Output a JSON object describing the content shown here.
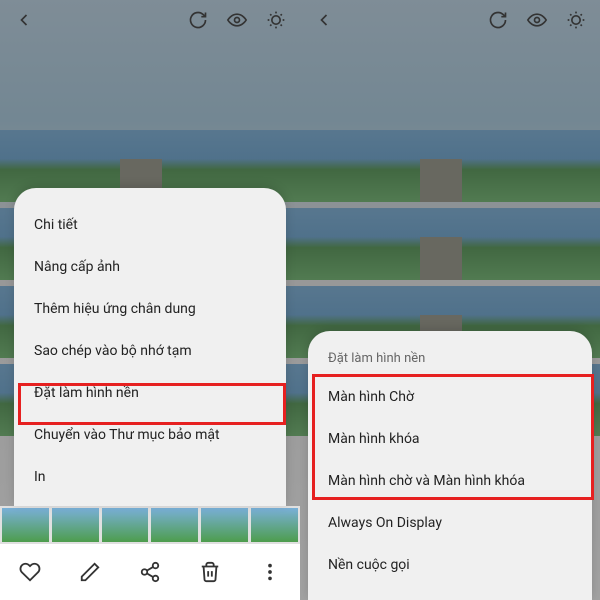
{
  "left": {
    "menu": {
      "items": [
        "Chi tiết",
        "Nâng cấp ảnh",
        "Thêm hiệu ứng chân dung",
        "Sao chép vào bộ nhớ tạm",
        "Đặt làm hình nền",
        "Chuyển vào Thư mục bảo mật",
        "In"
      ],
      "highlight_index": 4
    }
  },
  "right": {
    "menu": {
      "title": "Đặt làm hình nền",
      "items": [
        "Màn hình Chờ",
        "Màn hình khóa",
        "Màn hình chờ và Màn hình khóa",
        "Always On Display",
        "Nền cuộc gọi"
      ],
      "highlight_start": 0,
      "highlight_end": 2
    }
  },
  "icons": {
    "back": "back-icon",
    "sync": "sync-icon",
    "eye": "eye-icon",
    "scan": "scan-icon",
    "heart": "heart-icon",
    "edit": "edit-icon",
    "share": "share-icon",
    "trash": "trash-icon",
    "more": "more-icon"
  }
}
